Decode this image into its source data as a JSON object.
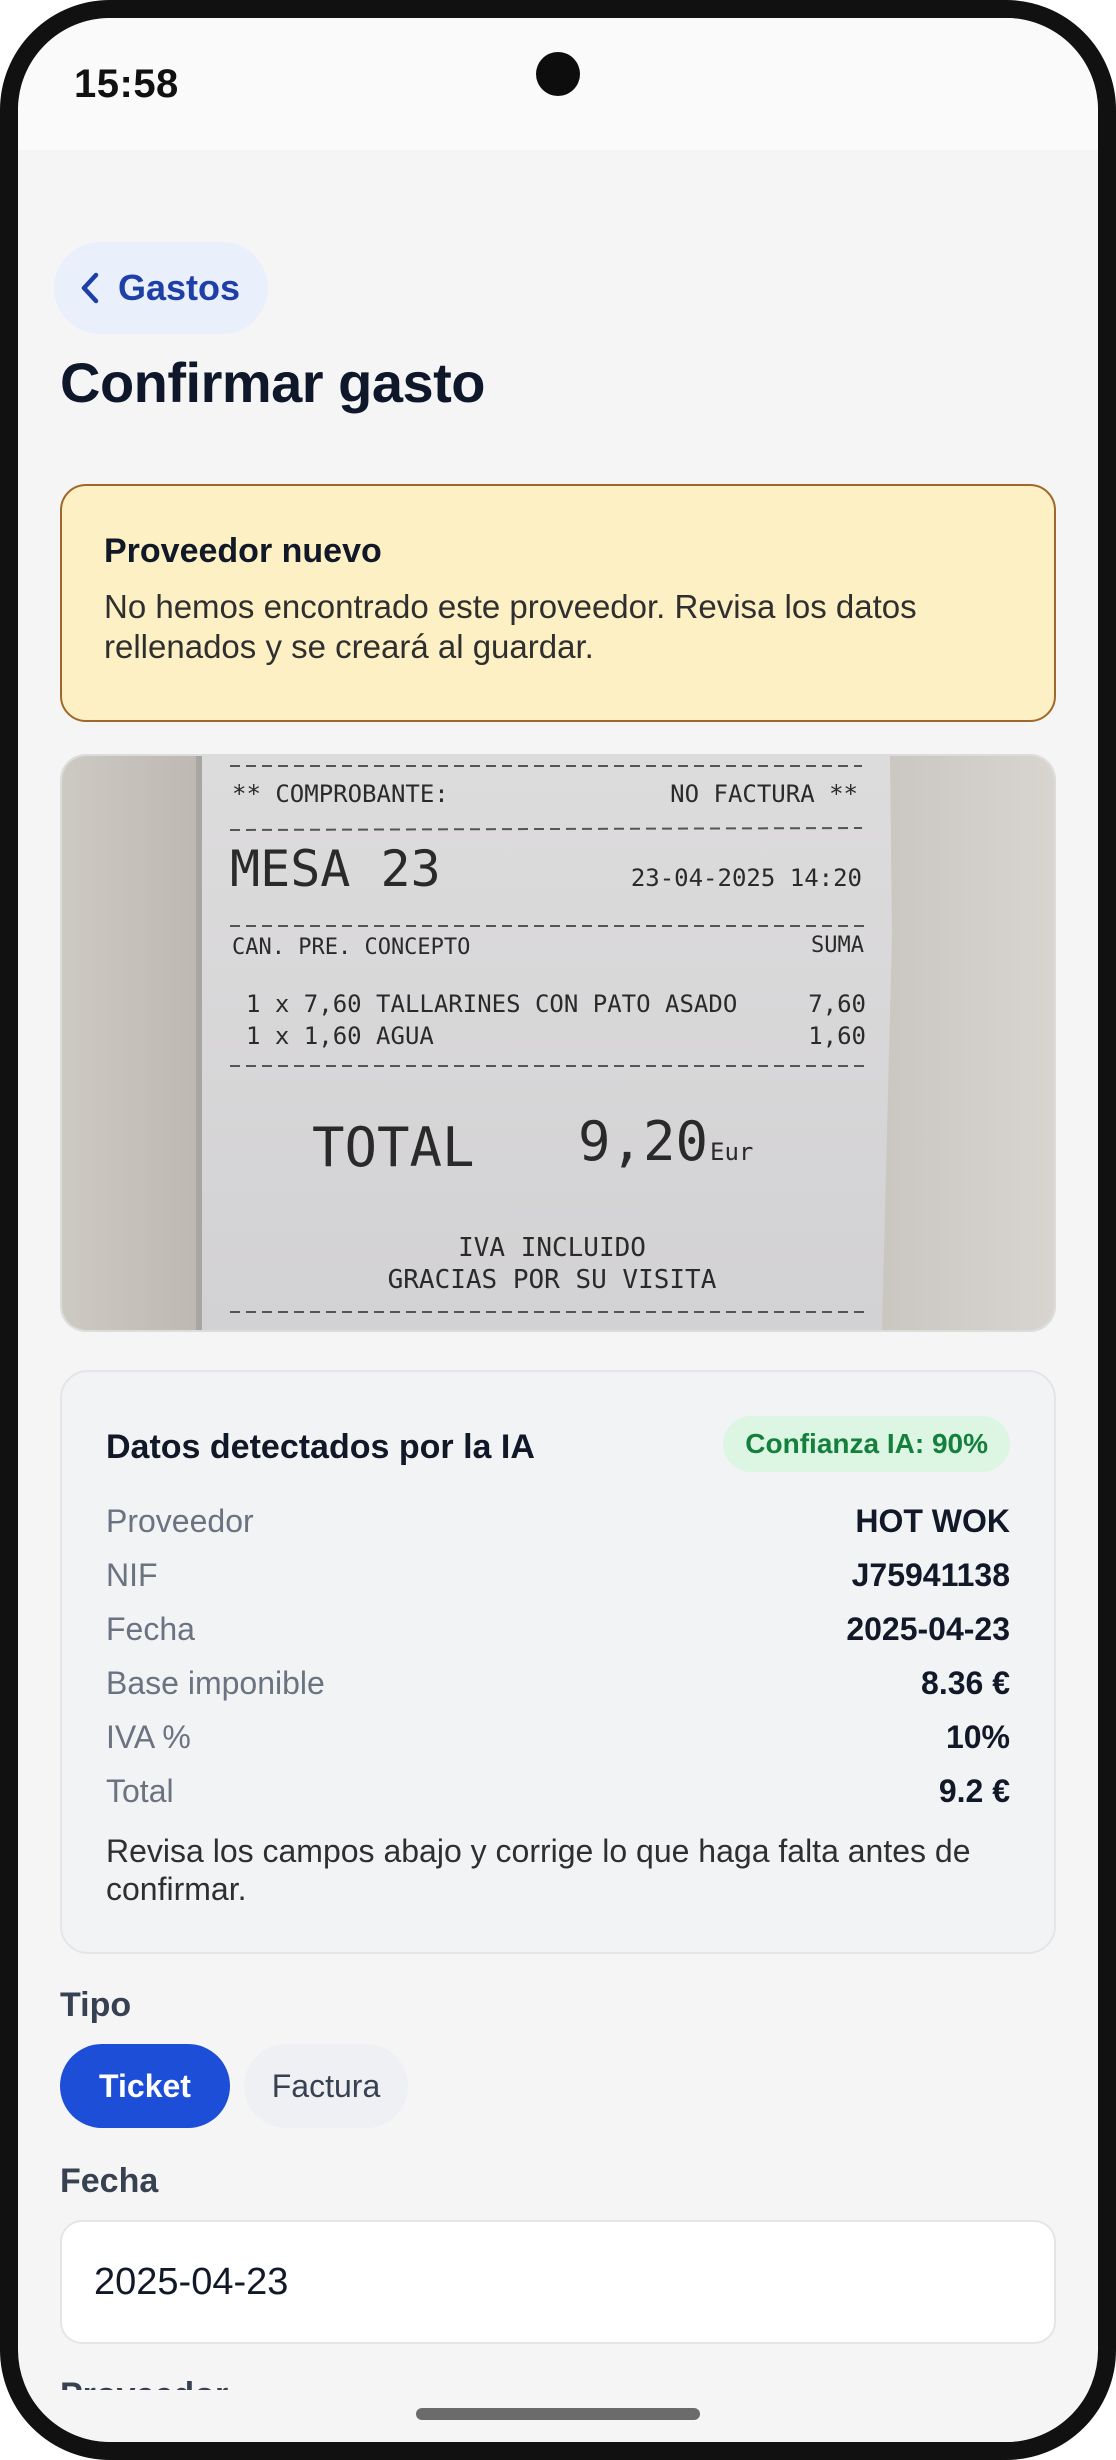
{
  "status_bar": {
    "time": "15:58"
  },
  "nav": {
    "back_label": "Gastos"
  },
  "page": {
    "title": "Confirmar gasto"
  },
  "alert": {
    "title": "Proveedor nuevo",
    "message": "No hemos encontrado este proveedor. Revisa los datos rellenados y se creará al guardar."
  },
  "receipt": {
    "line1_left": "** COMPROBANTE:",
    "line1_right": "NO FACTURA **",
    "table": "MESA 23",
    "datetime": "23-04-2025 14:20",
    "header_left": "CAN. PRE.  CONCEPTO",
    "header_right": "SUMA",
    "items": [
      {
        "text": "1 x  7,60 TALLARINES CON PATO ASADO",
        "amount": "7,60"
      },
      {
        "text": "1 x  1,60 AGUA",
        "amount": "1,60"
      }
    ],
    "total_label": "TOTAL",
    "total_value": "9,20",
    "currency": "Eur",
    "footer1": "IVA INCLUIDO",
    "footer2": "GRACIAS POR SU VISITA"
  },
  "ai": {
    "title": "Datos detectados por la IA",
    "confidence": "Confianza IA: 90%",
    "rows": [
      {
        "label": "Proveedor",
        "value": "HOT WOK"
      },
      {
        "label": "NIF",
        "value": "J75941138"
      },
      {
        "label": "Fecha",
        "value": "2025-04-23"
      },
      {
        "label": "Base imponible",
        "value": "8.36 €"
      },
      {
        "label": "IVA %",
        "value": "10%"
      },
      {
        "label": "Total",
        "value": "9.2 €"
      }
    ],
    "note": "Revisa los campos abajo y corrige lo que haga falta antes de confirmar."
  },
  "form": {
    "tipo_label": "Tipo",
    "tipo_options": [
      "Ticket",
      "Factura"
    ],
    "tipo_selected": "Ticket",
    "fecha_label": "Fecha",
    "fecha_value": "2025-04-23",
    "proveedor_label": "Proveedor"
  },
  "colors": {
    "accent": "#1d4ed8",
    "warning_bg": "#fdf0c4",
    "warning_border": "#a0692b",
    "success_bg": "#dcf6e3",
    "success_text": "#15803d"
  }
}
